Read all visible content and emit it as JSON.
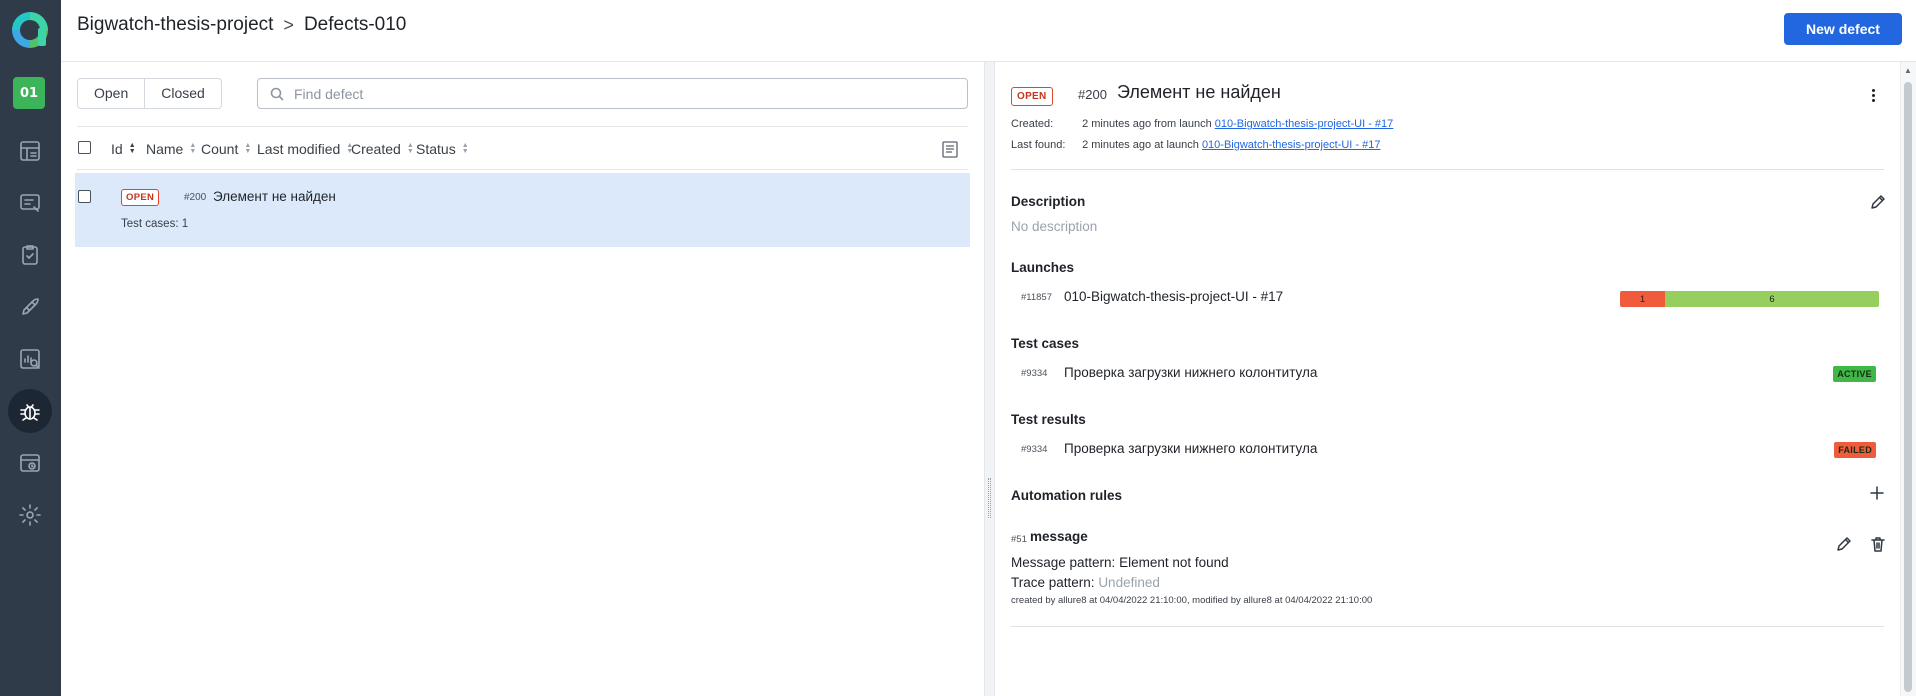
{
  "sidebar": {
    "project_avatar": "01",
    "items": [
      {
        "name": "dashboards-icon"
      },
      {
        "name": "launches-icon"
      },
      {
        "name": "test-cases-icon"
      },
      {
        "name": "jobs-icon"
      },
      {
        "name": "analytics-icon"
      },
      {
        "name": "defects-icon",
        "active": true
      },
      {
        "name": "test-plans-icon"
      },
      {
        "name": "settings-icon"
      }
    ]
  },
  "header": {
    "project": "Bigwatch-thesis-project",
    "separator": ">",
    "page": "Defects-010",
    "new_button": "New defect"
  },
  "list": {
    "filters": [
      "Open",
      "Closed"
    ],
    "search_placeholder": "Find defect",
    "columns": [
      "Id",
      "Name",
      "Count",
      "Last modified",
      "Created",
      "Status"
    ],
    "rows": [
      {
        "status": "OPEN",
        "id": "#200",
        "name": "Элемент не найден",
        "sub": "Test cases: 1"
      }
    ]
  },
  "detail": {
    "status": "OPEN",
    "id": "#200",
    "title": "Элемент не найден",
    "created_label": "Created:",
    "created_text": "2 minutes ago from launch",
    "created_link": "010-Bigwatch-thesis-project-UI - #17",
    "last_found_label": "Last found:",
    "last_found_text": "2 minutes ago at launch",
    "last_found_link": "010-Bigwatch-thesis-project-UI - #17",
    "description_title": "Description",
    "description_text": "No description",
    "launches_title": "Launches",
    "launch": {
      "id": "#11857",
      "name": "010-Bigwatch-thesis-project-UI - #17",
      "failed": "1",
      "passed": "6",
      "failed_count": 1,
      "passed_count": 6
    },
    "test_cases_title": "Test cases",
    "test_case": {
      "id": "#9334",
      "name": "Проверка загрузки нижнего колонтитула",
      "status": "ACTIVE"
    },
    "test_results_title": "Test results",
    "test_result": {
      "id": "#9334",
      "name": "Проверка загрузки нижнего колонтитула",
      "status": "FAILED"
    },
    "automation_title": "Automation rules",
    "rule": {
      "id": "#51",
      "name": "message",
      "message_label": "Message pattern:",
      "message_value": "Element not found",
      "trace_label": "Trace pattern:",
      "trace_value": "Undefined",
      "footer": "created by allure8 at 04/04/2022 21:10:00, modified by allure8 at 04/04/2022 21:10:00"
    }
  },
  "colors": {
    "accent": "#2267e0",
    "sidebar": "#2f3b48",
    "selected_row": "#dce9fb",
    "failed": "#ef5b3b",
    "passed": "#97cf5f",
    "active": "#40b848"
  }
}
